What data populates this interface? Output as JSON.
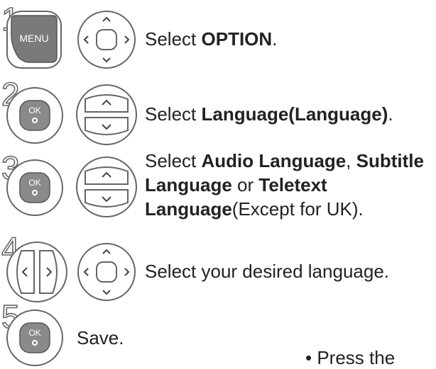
{
  "steps": [
    {
      "number": "1",
      "button_label": "MENU",
      "parts": [
        {
          "text": "Select ",
          "bold": false
        },
        {
          "text": "OPTION",
          "bold": true
        },
        {
          "text": ".",
          "bold": false
        }
      ]
    },
    {
      "number": "2",
      "button_label": "OK",
      "parts": [
        {
          "text": "Select ",
          "bold": false
        },
        {
          "text": "Language(Language)",
          "bold": true
        },
        {
          "text": ".",
          "bold": false
        }
      ]
    },
    {
      "number": "3",
      "button_label": "OK",
      "lines": [
        [
          {
            "text": "Select ",
            "bold": false
          },
          {
            "text": "Audio Language",
            "bold": true
          },
          {
            "text": ", ",
            "bold": false
          },
          {
            "text": "Subtitle",
            "bold": true
          }
        ],
        [
          {
            "text": "Language",
            "bold": true
          },
          {
            "text": " or ",
            "bold": false
          },
          {
            "text": "Teletext",
            "bold": true
          }
        ],
        [
          {
            "text": "Language",
            "bold": true
          },
          {
            "text": "(Except for UK).",
            "bold": false
          }
        ]
      ]
    },
    {
      "number": "4",
      "parts": [
        {
          "text": "Select your desired language.",
          "bold": false
        }
      ]
    },
    {
      "number": "5",
      "button_label": "OK",
      "parts": [
        {
          "text": "Save.",
          "bold": false
        }
      ]
    }
  ],
  "footnote": "• Press the"
}
